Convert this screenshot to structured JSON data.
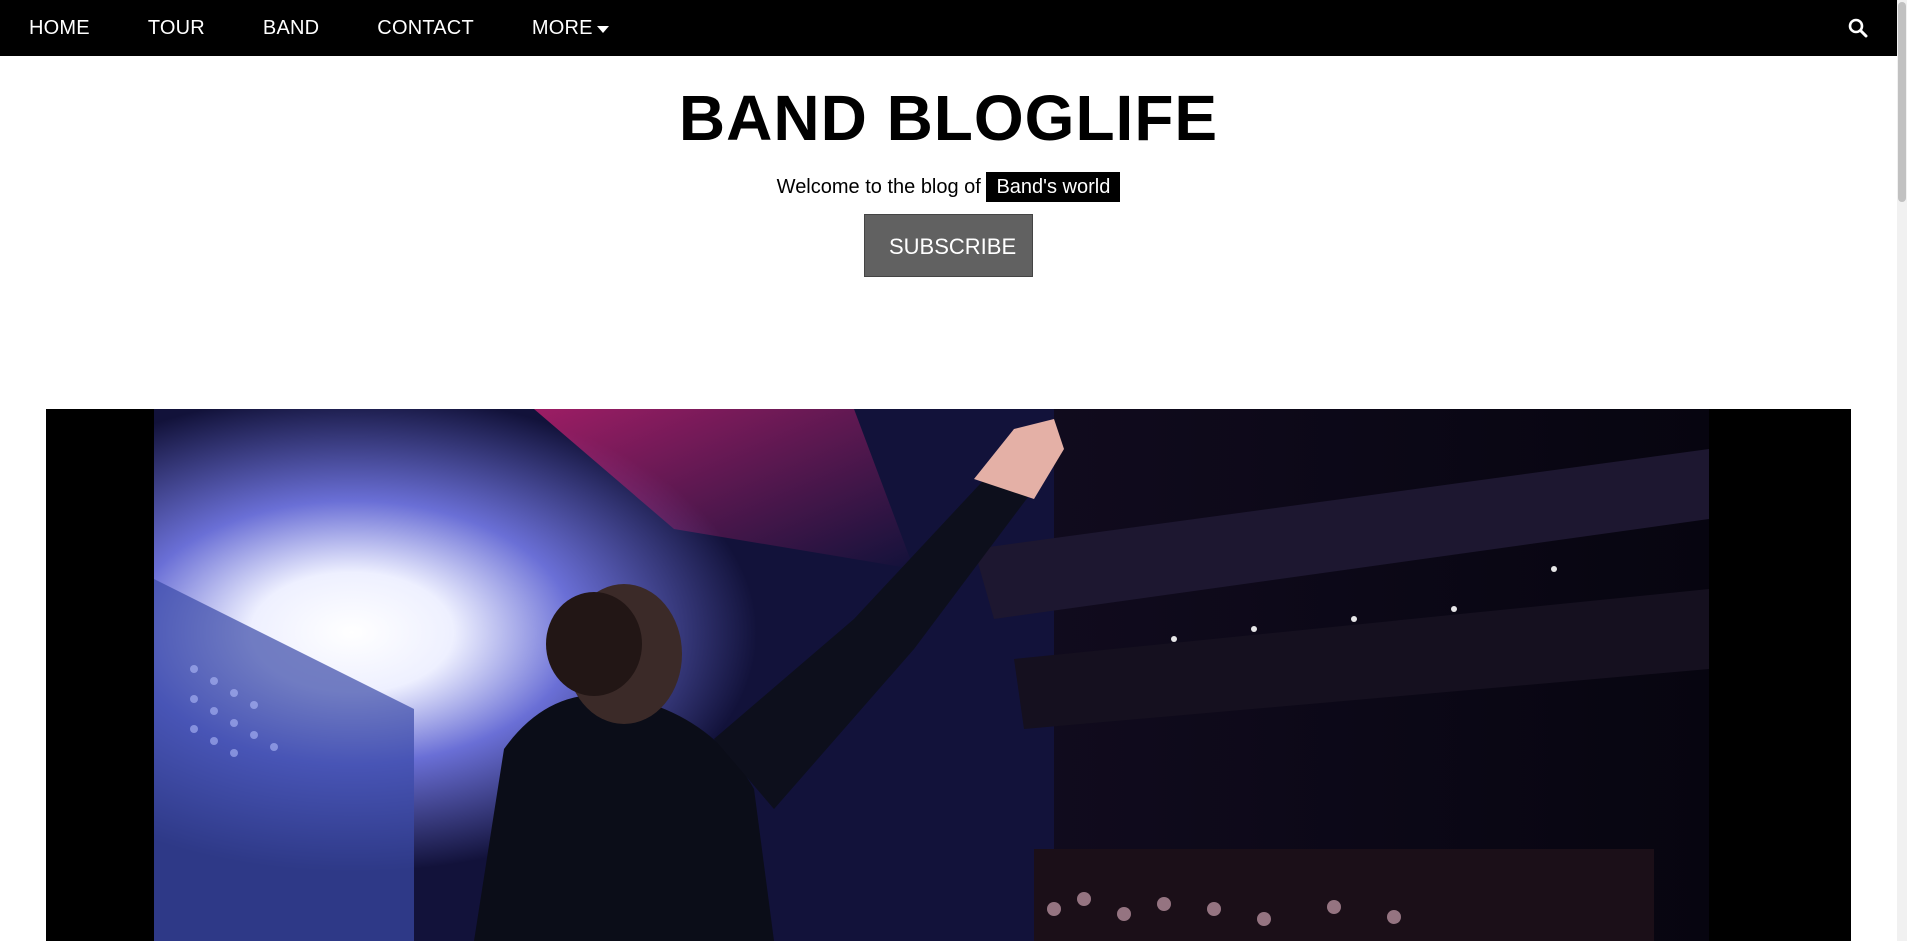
{
  "nav": {
    "items": [
      {
        "label": "HOME"
      },
      {
        "label": "TOUR"
      },
      {
        "label": "BAND"
      },
      {
        "label": "CONTACT"
      },
      {
        "label": "MORE"
      }
    ],
    "more_icon": "caret-down-icon",
    "search_icon": "search-icon"
  },
  "header": {
    "title": "BAND BLOGLIFE",
    "tagline_prefix": "Welcome to the blog of",
    "tagline_highlight": "Band's world",
    "subscribe_label": "SUBSCRIBE"
  },
  "hero": {
    "image": "concert-stage-photo"
  },
  "colors": {
    "nav_bg": "#000000",
    "button_bg": "#616161",
    "highlight_bg": "#000000"
  }
}
